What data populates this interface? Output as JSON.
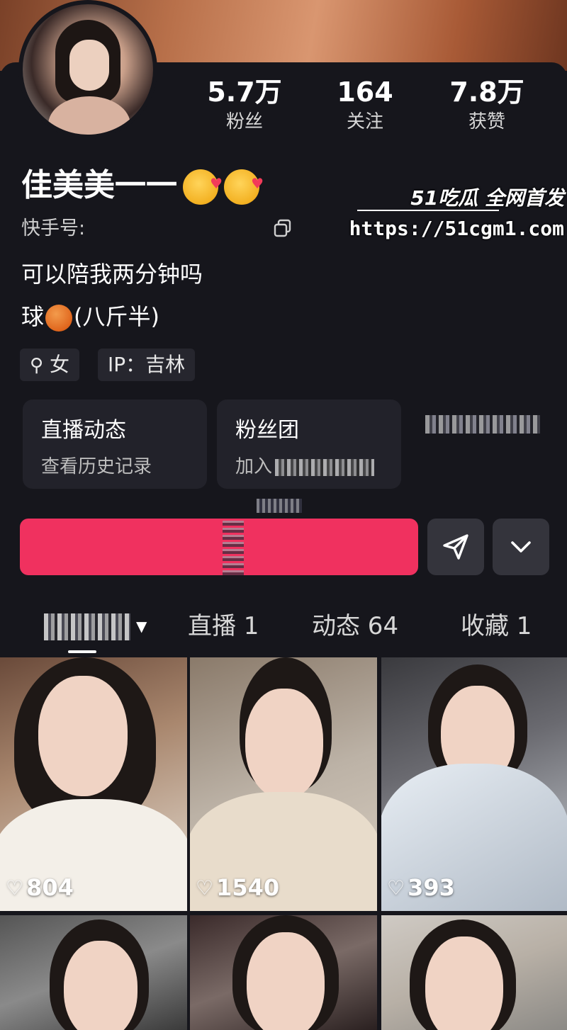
{
  "profile": {
    "name": "佳美美一一",
    "kuaishou_id_label": "快手号:",
    "bio_line1": "可以陪我两分钟吗",
    "bio_line2_prefix": "球",
    "bio_line2_suffix": "(八斤半)",
    "gender_chip": "女",
    "ip_chip": "IP：吉林"
  },
  "stats": [
    {
      "value": "5.7万",
      "label": "粉丝"
    },
    {
      "value": "164",
      "label": "关注"
    },
    {
      "value": "7.8万",
      "label": "获赞"
    }
  ],
  "tiles": {
    "live": {
      "title": "直播动态",
      "subtitle": "查看历史记录"
    },
    "fans": {
      "title": "粉丝团",
      "subtitle": "加入"
    }
  },
  "tabs": [
    {
      "label": "直播 1"
    },
    {
      "label": "动态 64"
    },
    {
      "label": "收藏 1"
    }
  ],
  "videos": [
    {
      "likes": "804"
    },
    {
      "likes": "1540"
    },
    {
      "likes": "393"
    }
  ],
  "watermark": {
    "title": "51吃瓜 全网首发",
    "url": "https://51cgm1.com"
  },
  "colors": {
    "follow_button": "#f0315f",
    "background": "#16161c"
  }
}
